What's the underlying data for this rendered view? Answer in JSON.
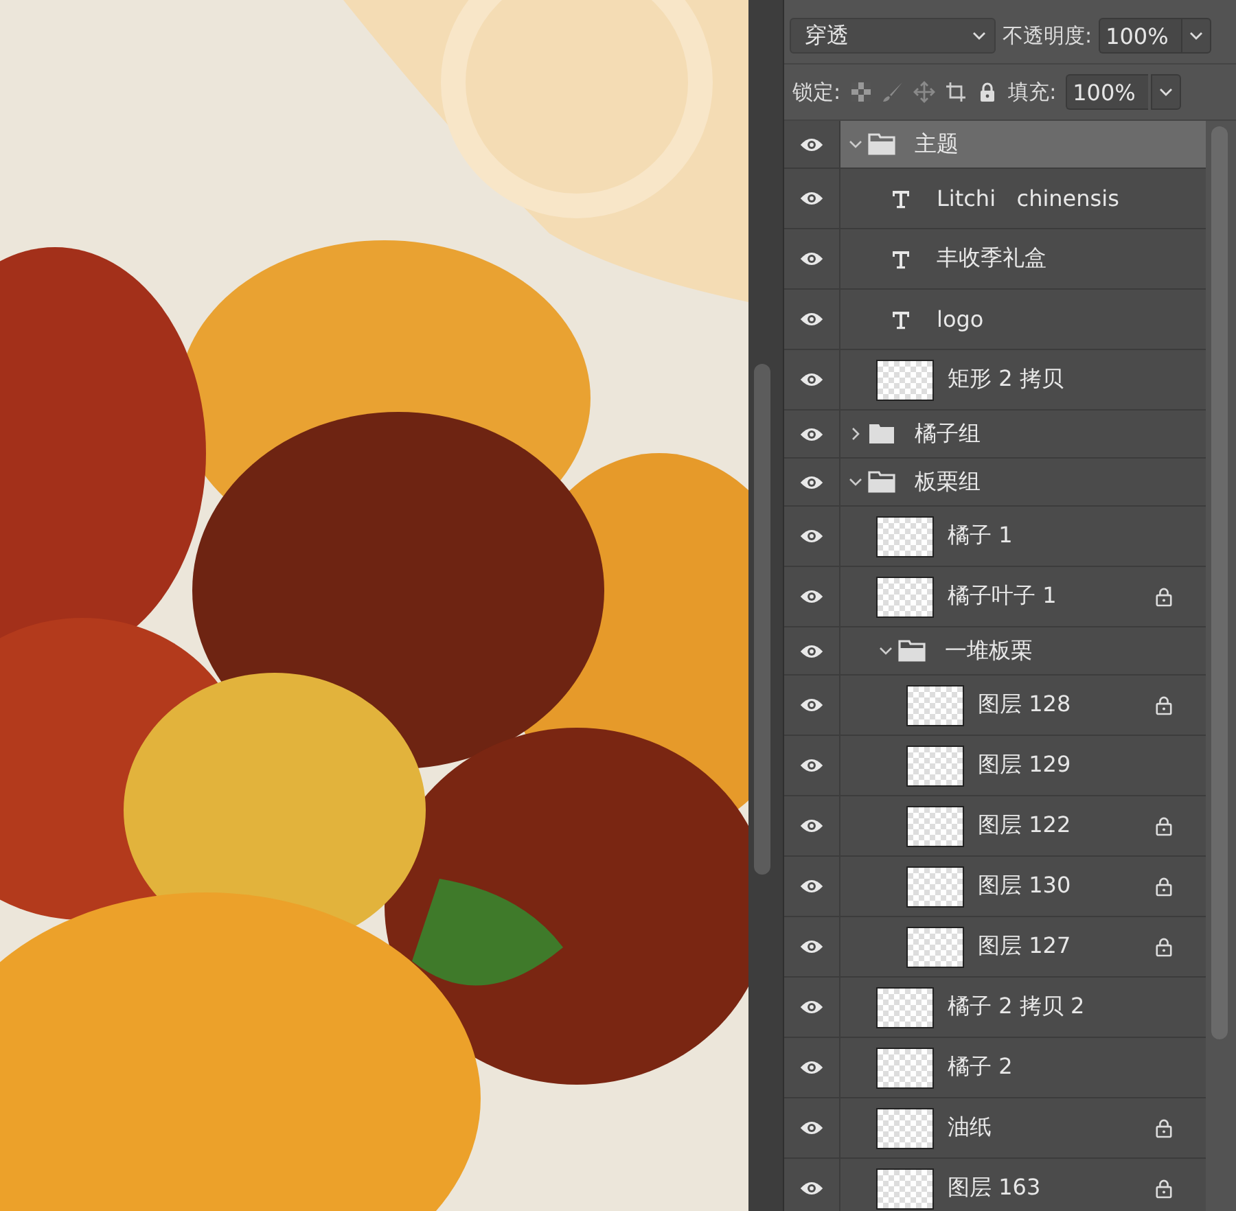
{
  "blend_mode": {
    "value": "穿透"
  },
  "opacity": {
    "label": "不透明度:",
    "value": "100%"
  },
  "lock": {
    "label": "锁定:"
  },
  "fill": {
    "label": "填充:",
    "value": "100%"
  },
  "layers": [
    {
      "kind": "group",
      "name": "主题",
      "visible": true,
      "selected": true,
      "locked": false,
      "expanded": true,
      "children": [
        {
          "kind": "text",
          "name": "Litchi   chinensis",
          "visible": true,
          "selected": false,
          "locked": false
        },
        {
          "kind": "text",
          "name": "丰收季礼盒",
          "visible": true,
          "selected": false,
          "locked": false
        },
        {
          "kind": "text",
          "name": "logo",
          "visible": true,
          "selected": false,
          "locked": false
        },
        {
          "kind": "pixel",
          "name": "矩形 2 拷贝",
          "visible": true,
          "selected": false,
          "locked": false
        }
      ]
    },
    {
      "kind": "group",
      "name": "橘子组",
      "visible": true,
      "selected": false,
      "locked": false,
      "expanded": false
    },
    {
      "kind": "group",
      "name": "板栗组",
      "visible": true,
      "selected": false,
      "locked": false,
      "expanded": true,
      "children": [
        {
          "kind": "pixel",
          "name": "橘子 1",
          "visible": true,
          "selected": false,
          "locked": false
        },
        {
          "kind": "pixel",
          "name": "橘子叶子 1",
          "visible": true,
          "selected": false,
          "locked": true
        },
        {
          "kind": "group",
          "name": "一堆板栗",
          "visible": true,
          "selected": false,
          "locked": false,
          "expanded": true,
          "children": [
            {
              "kind": "pixel",
              "name": "图层 128",
              "visible": true,
              "selected": false,
              "locked": true
            },
            {
              "kind": "pixel",
              "name": "图层 129",
              "visible": true,
              "selected": false,
              "locked": false
            },
            {
              "kind": "pixel",
              "name": "图层 122",
              "visible": true,
              "selected": false,
              "locked": true
            },
            {
              "kind": "pixel",
              "name": "图层 130",
              "visible": true,
              "selected": false,
              "locked": true
            },
            {
              "kind": "pixel",
              "name": "图层 127",
              "visible": true,
              "selected": false,
              "locked": true
            }
          ]
        },
        {
          "kind": "pixel",
          "name": "橘子 2 拷贝 2",
          "visible": true,
          "selected": false,
          "locked": false
        },
        {
          "kind": "pixel",
          "name": "橘子 2",
          "visible": true,
          "selected": false,
          "locked": false
        },
        {
          "kind": "pixel",
          "name": "油纸",
          "visible": true,
          "selected": false,
          "locked": true
        },
        {
          "kind": "pixel",
          "name": "图层 163",
          "visible": true,
          "selected": false,
          "locked": true
        }
      ]
    }
  ]
}
